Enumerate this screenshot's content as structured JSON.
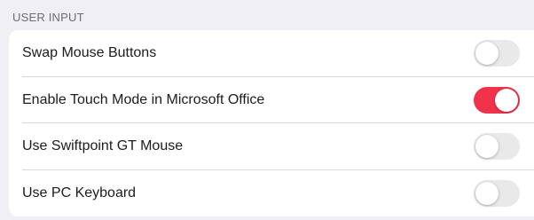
{
  "section": {
    "title": "USER INPUT"
  },
  "colors": {
    "toggle_on": "#f0334a",
    "toggle_off": "#e9e9ea"
  },
  "settings": [
    {
      "label": "Swap Mouse Buttons",
      "enabled": false
    },
    {
      "label": "Enable Touch Mode in Microsoft Office",
      "enabled": true
    },
    {
      "label": "Use Swiftpoint GT Mouse",
      "enabled": false
    },
    {
      "label": "Use PC Keyboard",
      "enabled": false
    }
  ]
}
